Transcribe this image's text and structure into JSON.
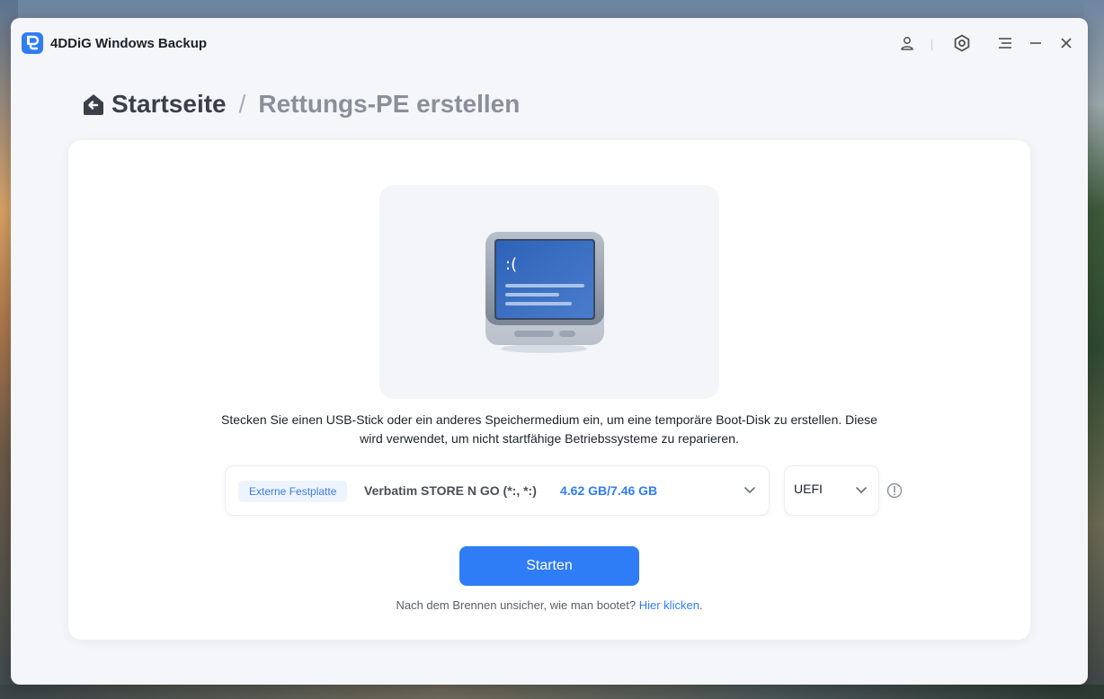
{
  "app": {
    "title": "4DDiG Windows Backup",
    "accent_color": "#2f7df6"
  },
  "titlebar": {
    "icons": [
      "user-icon",
      "settings-icon",
      "menu-icon",
      "minimize-icon",
      "close-icon"
    ]
  },
  "breadcrumb": {
    "home": "Startseite",
    "separator": "/",
    "current": "Rettungs-PE erstellen"
  },
  "main": {
    "illustration": "bsod-computer-icon",
    "description": "Stecken Sie einen USB-Stick oder ein anderes Speichermedium ein, um eine temporäre Boot-Disk zu erstellen. Diese wird verwendet, um nicht startfähige Betriebssysteme zu reparieren.",
    "drive": {
      "badge": "Externe Festplatte",
      "name": "Verbatim STORE N GO (*:, *:)",
      "size": "4.62 GB/7.46 GB"
    },
    "boot_mode": {
      "value": "UEFI"
    },
    "start_button": "Starten",
    "hint_text": "Nach dem Brennen unsicher, wie man bootet?",
    "hint_link": "Hier klicken",
    "hint_suffix": "."
  }
}
